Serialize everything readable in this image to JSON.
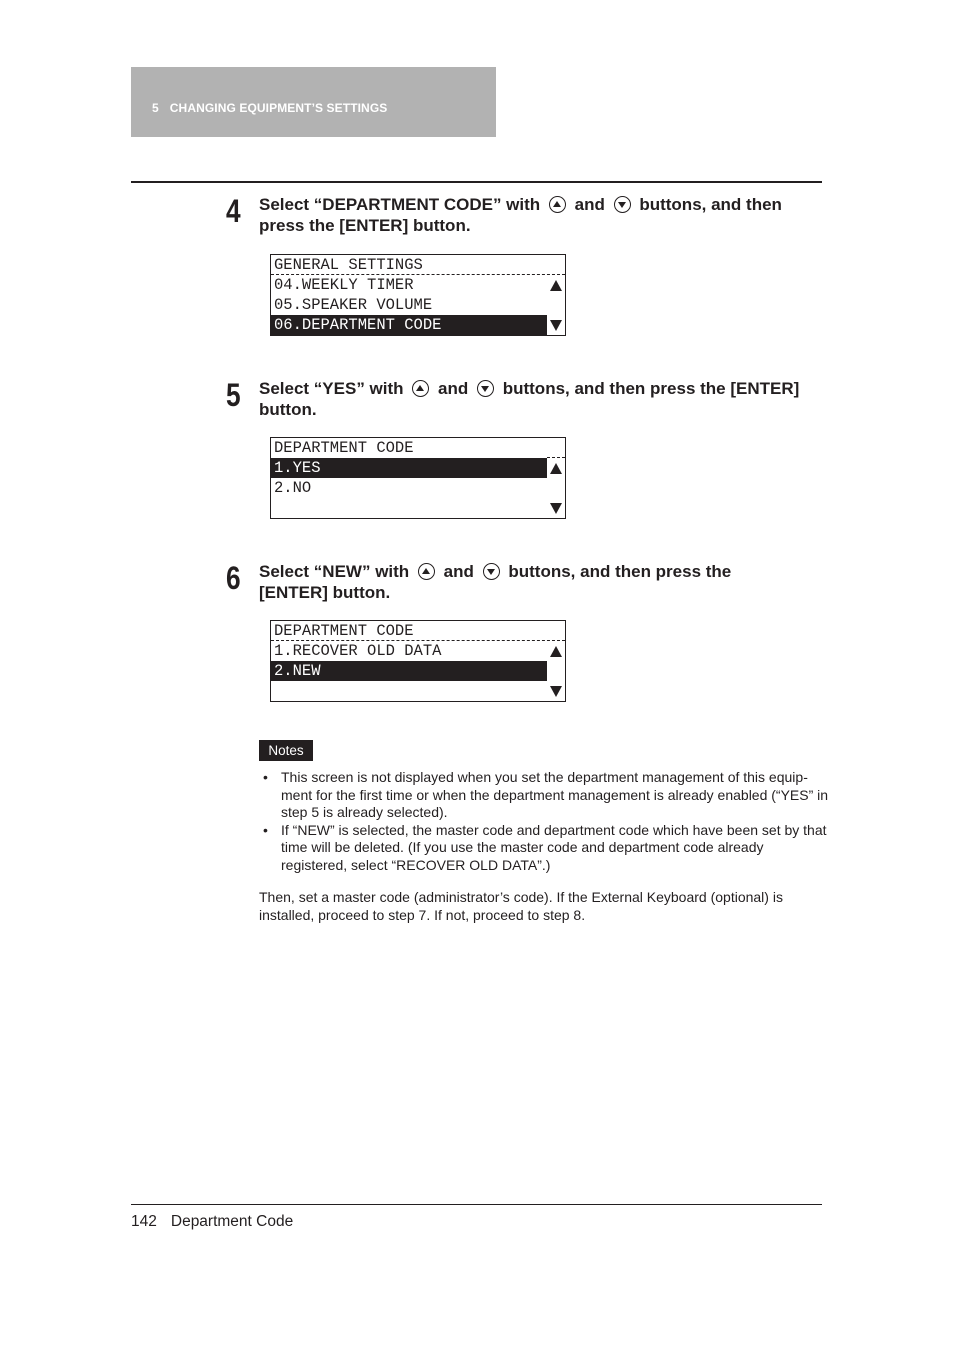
{
  "header": {
    "chapter_number": "5",
    "chapter_title": "CHANGING EQUIPMENT’S SETTINGS"
  },
  "steps": [
    {
      "number": "4",
      "text_before": "Select “DEPARTMENT CODE” with",
      "text_middle": "and",
      "text_after": "buttons, and then press the [ENTER] button.",
      "up_icon": "up-arrow-button-icon",
      "down_icon": "down-arrow-button-icon",
      "lcd": {
        "title": "GENERAL SETTINGS",
        "rows": [
          "04.WEEKLY TIMER",
          "05.SPEAKER VOLUME",
          "06.DEPARTMENT CODE"
        ],
        "selected_index": 2,
        "scroll_up_icon": "triangle-up-icon",
        "scroll_down_icon": "triangle-down-icon"
      }
    },
    {
      "number": "5",
      "text_before": "Select “YES” with",
      "text_middle": "and",
      "text_after": "buttons, and then press the [ENTER] button.",
      "up_icon": "up-arrow-button-icon",
      "down_icon": "down-arrow-button-icon",
      "lcd": {
        "title": "DEPARTMENT CODE",
        "rows": [
          "1.YES",
          "2.NO",
          ""
        ],
        "selected_index": 0,
        "scroll_up_icon": "triangle-up-icon",
        "scroll_down_icon": "triangle-down-icon"
      }
    },
    {
      "number": "6",
      "text_before": "Select “NEW” with",
      "text_middle": "and",
      "text_after": "buttons, and then press the [ENTER] button.",
      "up_icon": "up-arrow-button-icon",
      "down_icon": "down-arrow-button-icon",
      "lcd": {
        "title": "DEPARTMENT CODE",
        "rows": [
          "1.RECOVER OLD DATA",
          "2.NEW",
          ""
        ],
        "selected_index": 1,
        "scroll_up_icon": "triangle-up-icon",
        "scroll_down_icon": "triangle-down-icon"
      }
    }
  ],
  "notes": {
    "label": "Notes",
    "bullet": "•",
    "items": [
      "This screen is not displayed when you set the department management of this equip-ment for the first time or when the department management is already enabled (“YES” in step 5 is already selected).",
      "If “NEW” is selected, the master code and department code which have been set by that time will be deleted. (If you use the master code and department code already registered, select “RECOVER OLD DATA”.)"
    ]
  },
  "paragraph": "Then, set a master code (administrator’s code). If the External Keyboard (optional) is installed, proceed to step 7. If not, proceed to step 8.",
  "footer": {
    "page_number": "142",
    "section_title": "Department Code"
  }
}
